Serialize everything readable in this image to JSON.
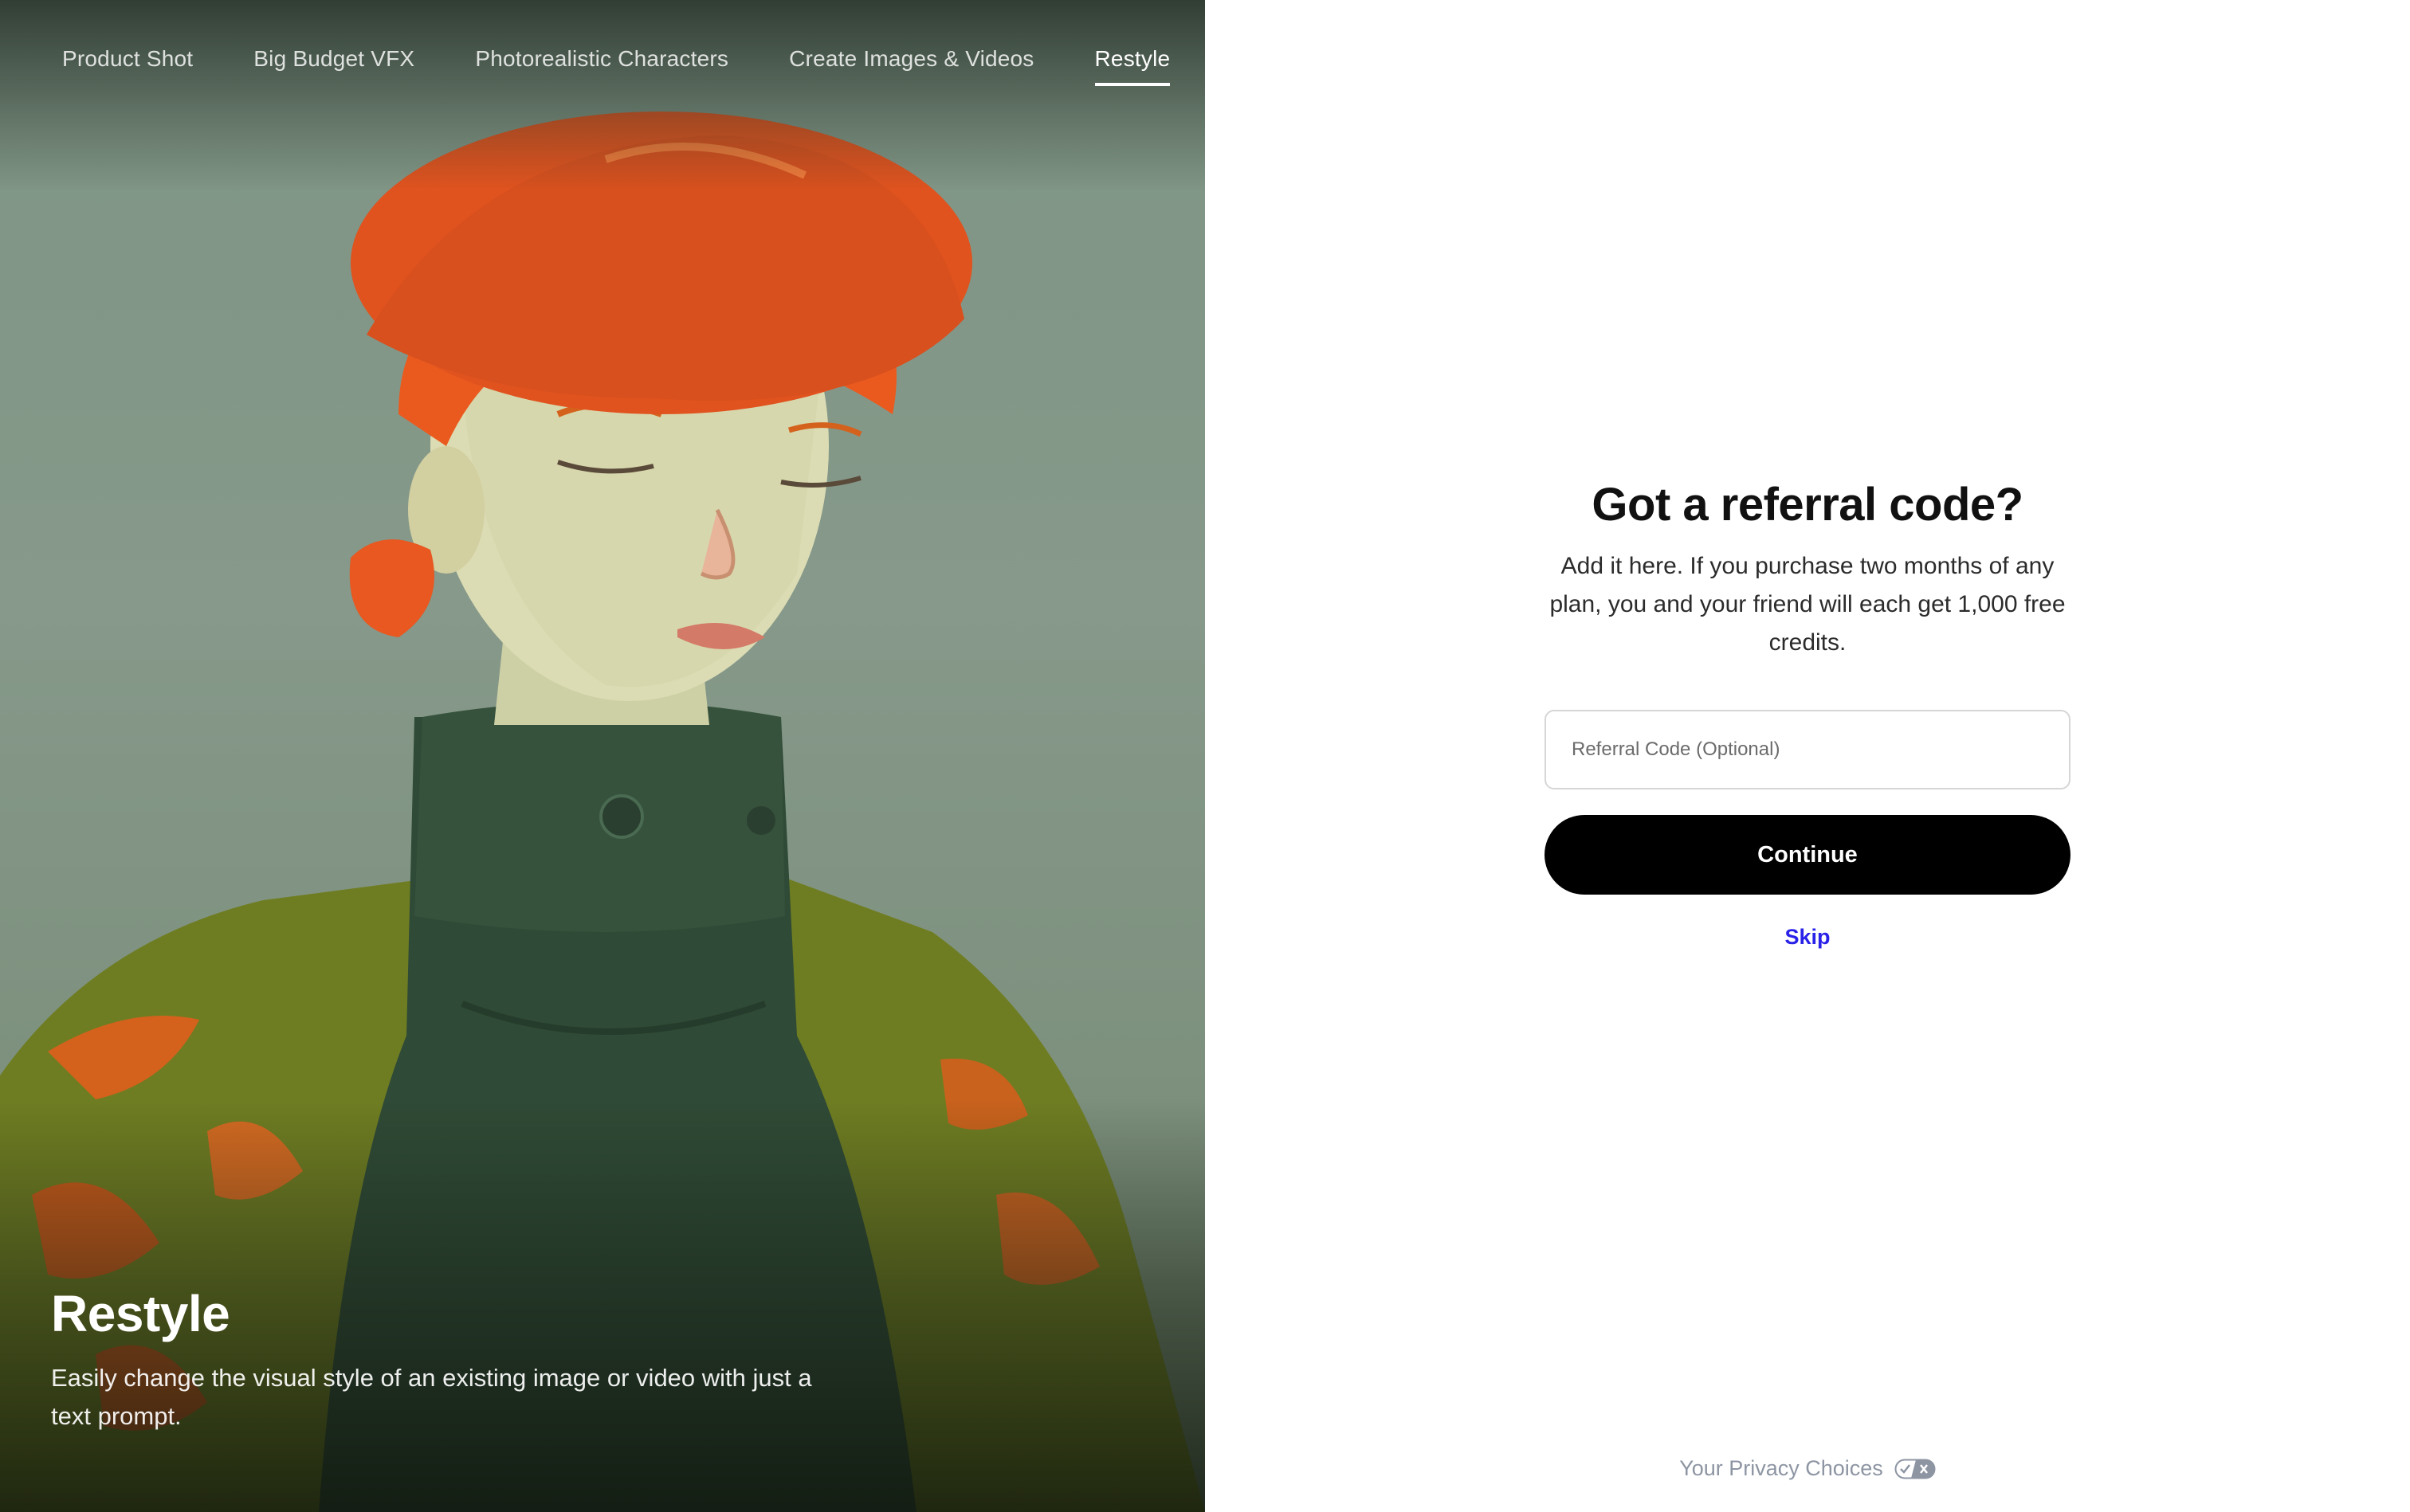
{
  "nav": {
    "items": [
      {
        "label": "Product Shot"
      },
      {
        "label": "Big Budget VFX"
      },
      {
        "label": "Photorealistic Characters"
      },
      {
        "label": "Create Images & Videos"
      },
      {
        "label": "Restyle"
      }
    ],
    "active": "Restyle"
  },
  "hero": {
    "title": "Restyle",
    "description": "Easily change the visual style of an existing image or video with just a text prompt."
  },
  "form": {
    "title": "Got a referral code?",
    "description": "Add it here. If you purchase two months of any plan, you and your friend will each get 1,000 free credits.",
    "input_placeholder": "Referral Code (Optional)",
    "input_value": "",
    "continue_label": "Continue",
    "skip_label": "Skip"
  },
  "footer": {
    "privacy_label": "Your Privacy Choices",
    "privacy_icon": "privacy-toggle-icon"
  },
  "colors": {
    "accent_link": "#2a22e8",
    "button_bg": "#000000",
    "hero_hat": "#e0531f",
    "hero_coat": "#7a8a22"
  }
}
